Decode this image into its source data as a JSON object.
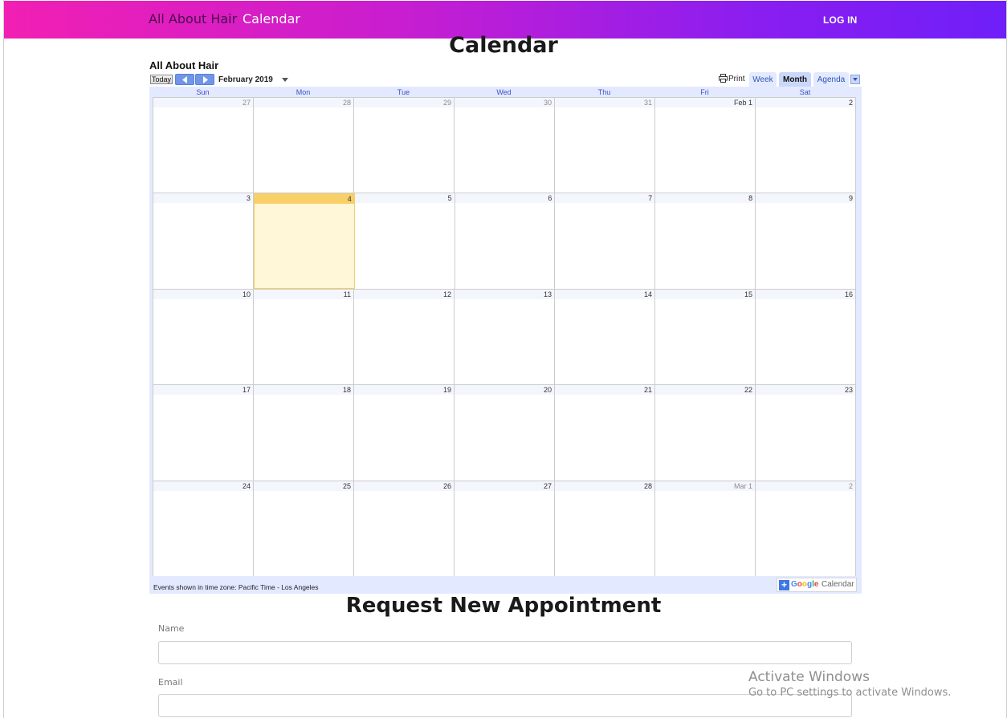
{
  "nav": {
    "brand": "All About Hair",
    "calendar_link": "Calendar",
    "login": "LOG IN"
  },
  "page_heading": "Calendar",
  "calendar": {
    "title": "All About Hair",
    "today_label": "Today",
    "month_label": "February 2019",
    "print_label": "Print",
    "views": [
      "Week",
      "Month",
      "Agenda"
    ],
    "active_view": "Month",
    "weekdays": [
      "Sun",
      "Mon",
      "Tue",
      "Wed",
      "Thu",
      "Fri",
      "Sat"
    ],
    "weeks": [
      [
        "27",
        "28",
        "29",
        "30",
        "31",
        "Feb 1",
        "2"
      ],
      [
        "3",
        "4",
        "5",
        "6",
        "7",
        "8",
        "9"
      ],
      [
        "10",
        "11",
        "12",
        "13",
        "14",
        "15",
        "16"
      ],
      [
        "17",
        "18",
        "19",
        "20",
        "21",
        "22",
        "23"
      ],
      [
        "24",
        "25",
        "26",
        "27",
        "28",
        "Mar 1",
        "2"
      ]
    ],
    "today": "4",
    "timezone_note": "Events shown in time zone: Pacific Time - Los Angeles",
    "badge": {
      "plus": "+",
      "google": "Google",
      "suffix": "Calendar"
    }
  },
  "request": {
    "heading": "Request New Appointment",
    "name_label": "Name",
    "email_label": "Email",
    "name_value": "",
    "email_value": ""
  },
  "watermark": {
    "title": "Activate Windows",
    "subtitle": "Go to PC settings to activate Windows."
  },
  "colors": {
    "nav_gradient_start": "#f21fb3",
    "nav_gradient_end": "#6f1ff8",
    "calendar_frame": "#e3e9ff",
    "today_highlight": "#fff7d7",
    "today_header": "#f8cf68"
  }
}
